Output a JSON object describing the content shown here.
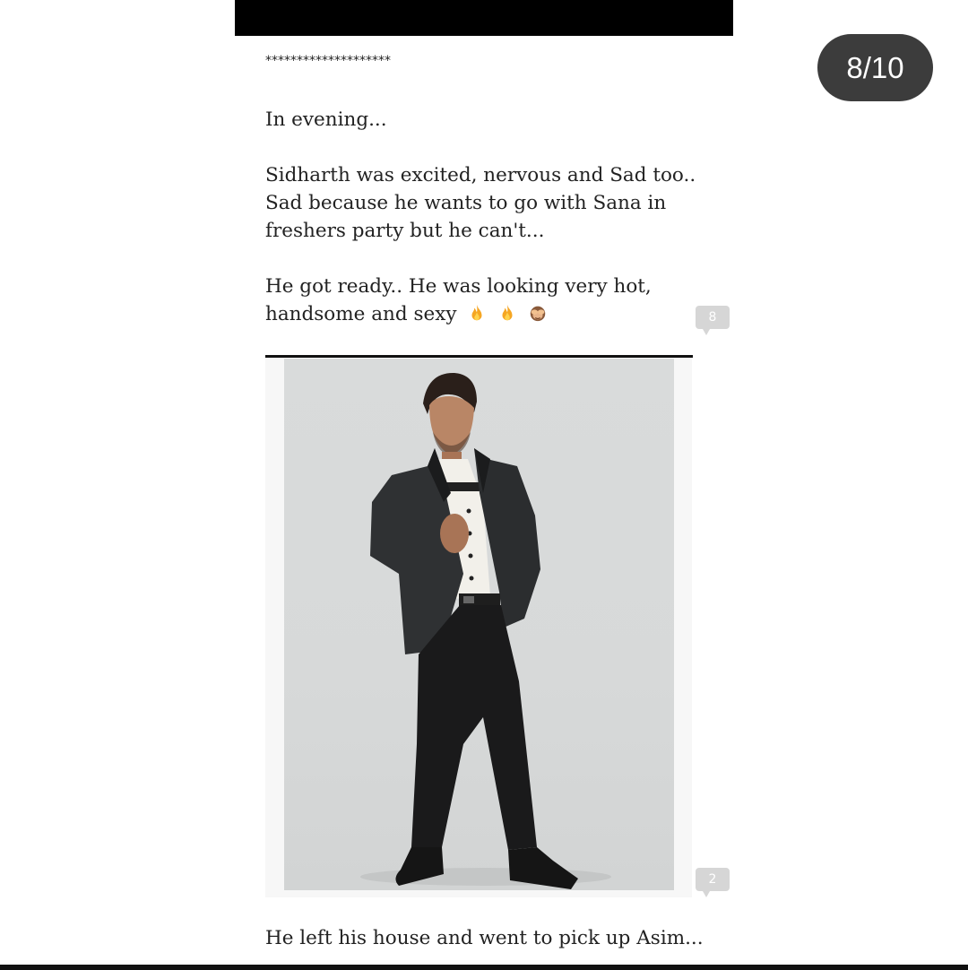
{
  "page_counter": "8/10",
  "story": {
    "separator": "********************",
    "para1": "In evening...",
    "para2_lines": [
      "Sidharth was excited, nervous and Sad too..",
      "Sad because he wants to go with Sana in",
      "freshers party but he can't..."
    ],
    "para3_lines": [
      "He got ready.. He was looking very hot,",
      "handsome and sexy"
    ],
    "para3_emojis": [
      "fire-icon",
      "fire-icon",
      "see-no-evil-monkey-icon"
    ],
    "comment_count_1": "8",
    "comment_count_2": "2",
    "para4": "He left his house and went to pick up Asim..."
  },
  "colors": {
    "counter_bg": "#3c3c3c",
    "comment_bubble": "#d6d6d6",
    "photo_bg": "#d9dbdb"
  }
}
